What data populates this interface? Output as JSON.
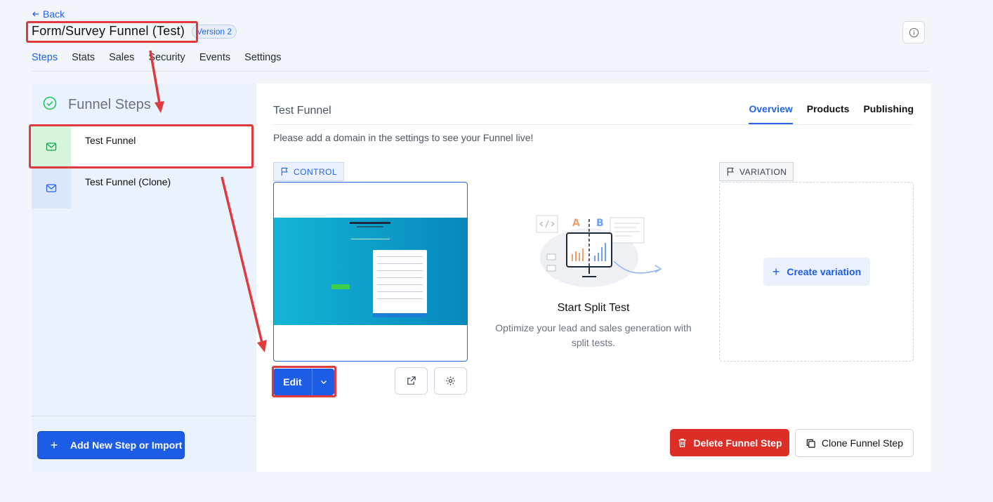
{
  "header": {
    "back_label": "Back",
    "title": "Form/Survey Funnel (Test)",
    "version": "Version 2"
  },
  "tabs": [
    {
      "label": "Steps",
      "active": true
    },
    {
      "label": "Stats"
    },
    {
      "label": "Sales"
    },
    {
      "label": "Security"
    },
    {
      "label": "Events"
    },
    {
      "label": "Settings"
    }
  ],
  "sidebar": {
    "title": "Funnel Steps",
    "steps": [
      {
        "label": "Test Funnel",
        "icon": "mail-icon",
        "selected": true
      },
      {
        "label": "Test Funnel (Clone)",
        "icon": "mail-icon"
      }
    ],
    "add_button": "Add New Step or Import"
  },
  "main": {
    "title": "Test Funnel",
    "tabs": [
      {
        "label": "Overview",
        "active": true
      },
      {
        "label": "Products"
      },
      {
        "label": "Publishing"
      }
    ],
    "notice": "Please add a domain in the settings to see your Funnel live!",
    "control_tag": "CONTROL",
    "variation_tag": "VARIATION",
    "edit_label": "Edit",
    "split_title": "Start Split Test",
    "split_desc": "Optimize your lead and sales generation with split tests.",
    "create_variation": "Create variation",
    "delete_label": "Delete Funnel Step",
    "clone_label": "Clone Funnel Step"
  },
  "colors": {
    "accent": "#1d5de6",
    "danger": "#dc2d26",
    "annotation": "#e03a3e"
  }
}
